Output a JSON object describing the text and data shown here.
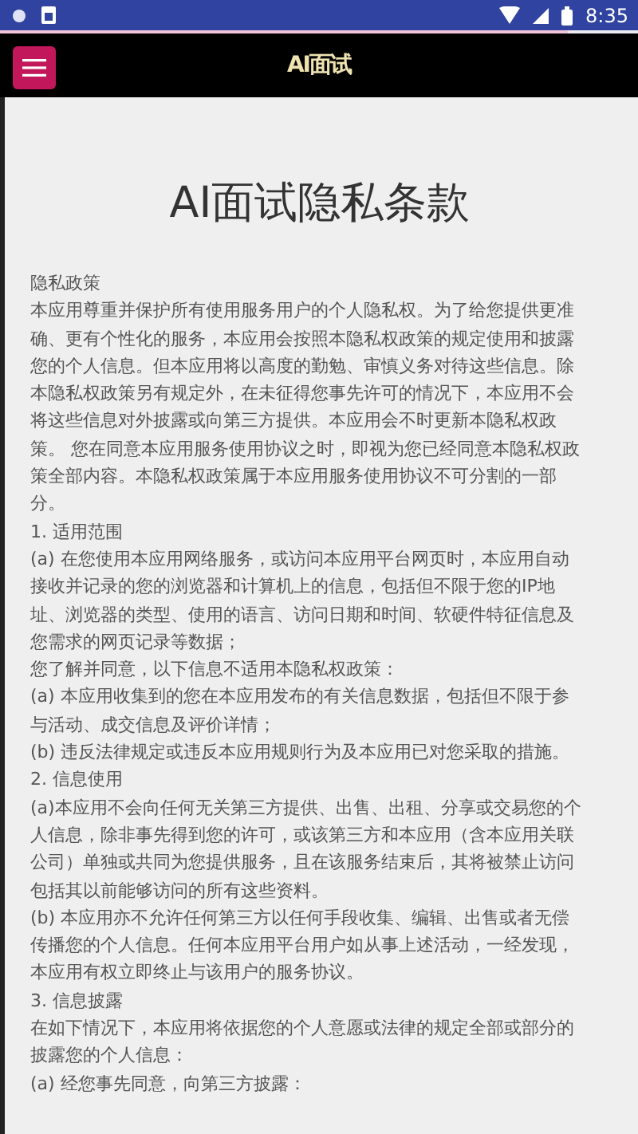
{
  "status_bar": {
    "time": "8:35"
  },
  "loading_bar": {
    "level": 0.89
  },
  "header": {
    "title": "AI面试"
  },
  "document": {
    "title": "AI面试隐私条款",
    "paragraphs": [
      "隐私政策",
      "本应用尊重并保护所有使用服务用户的个人隐私权。为了给您提供更准确、更有个性化的服务，本应用会按照本隐私权政策的规定使用和披露您的个人信息。但本应用将以高度的勤勉、审慎义务对待这些信息。除本隐私权政策另有规定外，在未征得您事先许可的情况下，本应用不会将这些信息对外披露或向第三方提供。本应用会不时更新本隐私权政策。 您在同意本应用服务使用协议之时，即视为您已经同意本隐私权政策全部内容。本隐私权政策属于本应用服务使用协议不可分割的一部分。",
      "1. 适用范围",
      "(a) 在您使用本应用网络服务，或访问本应用平台网页时，本应用自动接收并记录的您的浏览器和计算机上的信息，包括但不限于您的IP地址、浏览器的类型、使用的语言、访问日期和时间、软硬件特征信息及您需求的网页记录等数据；",
      "您了解并同意，以下信息不适用本隐私权政策：",
      "(a) 本应用收集到的您在本应用发布的有关信息数据，包括但不限于参与活动、成交信息及评价详情；",
      "(b) 违反法律规定或违反本应用规则行为及本应用已对您采取的措施。",
      "2. 信息使用",
      "(a)本应用不会向任何无关第三方提供、出售、出租、分享或交易您的个人信息，除非事先得到您的许可，或该第三方和本应用（含本应用关联公司）单独或共同为您提供服务，且在该服务结束后，其将被禁止访问包括其以前能够访问的所有这些资料。",
      "(b) 本应用亦不允许任何第三方以任何手段收集、编辑、出售或者无偿传播您的个人信息。任何本应用平台用户如从事上述活动，一经发现，本应用有权立即终止与该用户的服务协议。",
      "3. 信息披露",
      "在如下情况下，本应用将依据您的个人意愿或法律的规定全部或部分的披露您的个人信息：",
      "(a) 经您事先同意，向第三方披露："
    ]
  }
}
